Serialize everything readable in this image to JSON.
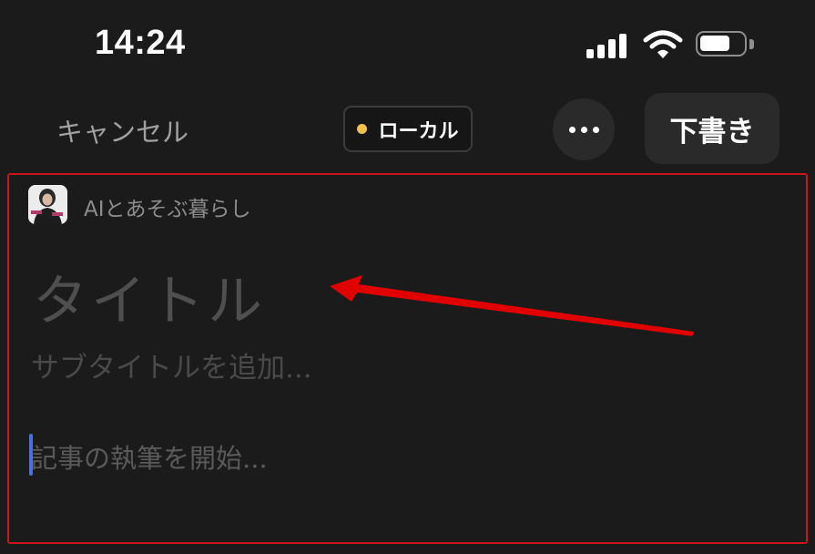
{
  "status_bar": {
    "time": "14:24",
    "icons": [
      "cellular-signal-icon",
      "wifi-icon",
      "battery-icon"
    ]
  },
  "nav": {
    "cancel_label": "キャンセル",
    "local_badge_label": "ローカル",
    "local_badge_dot_color": "#f0c24b",
    "more_icon": "ellipsis-icon",
    "draft_label": "下書き"
  },
  "editor": {
    "author_name": "AIとあそぶ暮らし",
    "avatar": "author-avatar",
    "title_placeholder": "タイトル",
    "subtitle_placeholder": "サブタイトルを追加...",
    "body_placeholder": "記事の執筆を開始..."
  },
  "annotation": {
    "highlight_color": "#c8161b",
    "arrow_color": "#e00000"
  }
}
